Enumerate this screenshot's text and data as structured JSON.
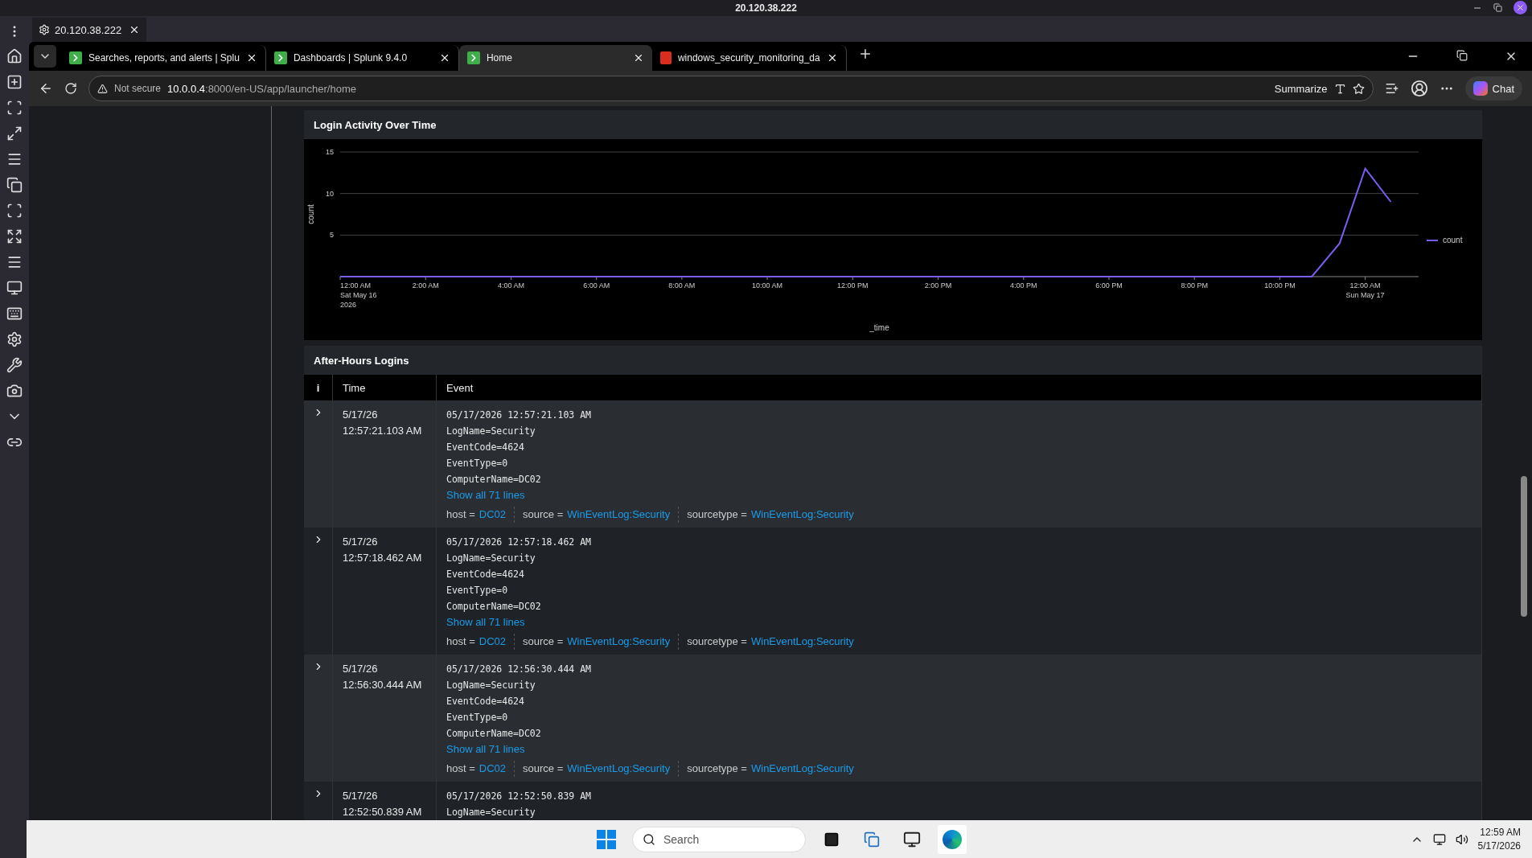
{
  "remote_window": {
    "title": "20.120.38.222",
    "tab": "20.120.38.222"
  },
  "browser": {
    "tabs": [
      {
        "title": "Searches, reports, and alerts | Splu",
        "kind": "splunk",
        "selected": false
      },
      {
        "title": "Dashboards | Splunk 9.4.0",
        "kind": "splunk",
        "selected": false
      },
      {
        "title": "Home",
        "kind": "splunk",
        "selected": true
      },
      {
        "title": "windows_security_monitoring_da",
        "kind": "pdf",
        "selected": false
      }
    ],
    "address": {
      "security": "Not secure",
      "host": "10.0.0.4",
      "path": ":8000/en-US/app/launcher/home"
    },
    "summarize": "Summarize",
    "chat": "Chat"
  },
  "chart_panel": {
    "title": "Login Activity Over Time",
    "chart_data": {
      "type": "line",
      "xlabel": "_time",
      "ylabel": "count",
      "x": [
        0,
        22.75,
        23.4,
        24,
        24.6
      ],
      "series": [
        {
          "name": "count",
          "color": "#7b5cf0",
          "values": [
            0,
            0,
            4,
            13,
            9
          ]
        }
      ],
      "xlim": [
        0,
        25.25
      ],
      "ylim": [
        0,
        15
      ],
      "xticks": [
        {
          "value": 0,
          "label": "12:00 AM\nSat May 16\n2026"
        },
        {
          "value": 2,
          "label": "2:00 AM"
        },
        {
          "value": 4,
          "label": "4:00 AM"
        },
        {
          "value": 6,
          "label": "6:00 AM"
        },
        {
          "value": 8,
          "label": "8:00 AM"
        },
        {
          "value": 10,
          "label": "10:00 AM"
        },
        {
          "value": 12,
          "label": "12:00 PM"
        },
        {
          "value": 14,
          "label": "2:00 PM"
        },
        {
          "value": 16,
          "label": "4:00 PM"
        },
        {
          "value": 18,
          "label": "6:00 PM"
        },
        {
          "value": 20,
          "label": "8:00 PM"
        },
        {
          "value": 22,
          "label": "10:00 PM"
        },
        {
          "value": 24,
          "label": "12:00 AM\nSun May 17"
        }
      ],
      "yticks": [
        5,
        10,
        15
      ]
    }
  },
  "table_panel": {
    "title": "After-Hours Logins",
    "columns": [
      "i",
      "Time",
      "Event"
    ],
    "rows": [
      {
        "date": "5/17/26",
        "time": "12:57:21.103 AM",
        "lines": [
          "05/17/2026 12:57:21.103 AM",
          "LogName=Security",
          "EventCode=4624",
          "EventType=0",
          "ComputerName=DC02"
        ],
        "show_all": "Show all 71 lines",
        "fields": [
          {
            "key": "host =",
            "value": "DC02"
          },
          {
            "key": "source =",
            "value": "WinEventLog:Security"
          },
          {
            "key": "sourcetype =",
            "value": "WinEventLog:Security"
          }
        ]
      },
      {
        "date": "5/17/26",
        "time": "12:57:18.462 AM",
        "lines": [
          "05/17/2026 12:57:18.462 AM",
          "LogName=Security",
          "EventCode=4624",
          "EventType=0",
          "ComputerName=DC02"
        ],
        "show_all": "Show all 71 lines",
        "fields": [
          {
            "key": "host =",
            "value": "DC02"
          },
          {
            "key": "source =",
            "value": "WinEventLog:Security"
          },
          {
            "key": "sourcetype =",
            "value": "WinEventLog:Security"
          }
        ]
      },
      {
        "date": "5/17/26",
        "time": "12:56:30.444 AM",
        "lines": [
          "05/17/2026 12:56:30.444 AM",
          "LogName=Security",
          "EventCode=4624",
          "EventType=0",
          "ComputerName=DC02"
        ],
        "show_all": "Show all 71 lines",
        "fields": [
          {
            "key": "host =",
            "value": "DC02"
          },
          {
            "key": "source =",
            "value": "WinEventLog:Security"
          },
          {
            "key": "sourcetype =",
            "value": "WinEventLog:Security"
          }
        ]
      },
      {
        "date": "5/17/26",
        "time": "12:52:50.839 AM",
        "lines": [
          "05/17/2026 12:52:50.839 AM",
          "LogName=Security"
        ]
      }
    ]
  },
  "taskbar": {
    "search": "Search",
    "time": "12:59 AM",
    "date": "5/17/2026"
  }
}
